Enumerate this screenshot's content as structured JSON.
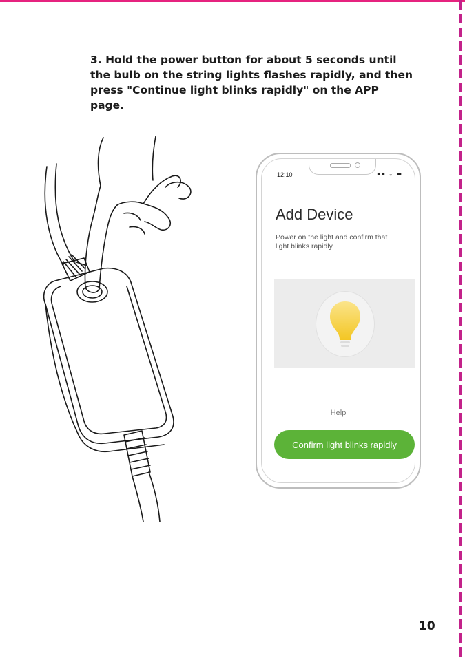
{
  "instruction": {
    "text": "3. Hold the power button for about 5 seconds until the bulb on the string lights flashes rapidly, and then press \"Continue light blinks rapidly\" on the APP page."
  },
  "phone": {
    "status_time": "12:10",
    "status_icons": "▪▪ ᯤ ▬",
    "screen_title": "Add Device",
    "description": "Power on the light and confirm that light blinks  rapidly",
    "help_label": "Help",
    "confirm_label": "Confirm light blinks rapidly",
    "bulb_icon": "lightbulb-icon"
  },
  "page_number": "10",
  "colors": {
    "accent_green": "#5cb338",
    "bulb_yellow": "#f5cc2e",
    "border_magenta": "#e6237f"
  }
}
